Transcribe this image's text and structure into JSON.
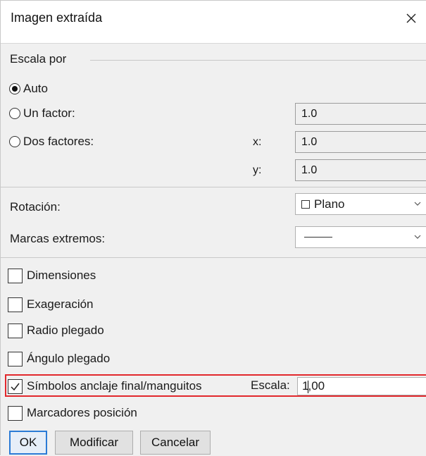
{
  "window": {
    "title": "Imagen extraída",
    "close_glyph": "×"
  },
  "scale_group": {
    "label": "Escala por",
    "options": [
      {
        "label": "Auto",
        "checked": true
      },
      {
        "label": "Un factor:",
        "checked": false
      },
      {
        "label": "Dos factores:",
        "checked": false
      }
    ],
    "un_factor_value": "1.0",
    "x_label": "x:",
    "x_value": "1.0",
    "y_label": "y:",
    "y_value": "1.0"
  },
  "rotation": {
    "label": "Rotación:",
    "value": "Plano"
  },
  "end_marks": {
    "label": "Marcas extremos:"
  },
  "checkboxes": [
    {
      "label": "Dimensiones",
      "checked": false
    },
    {
      "label": "Exageración",
      "checked": false
    },
    {
      "label": "Radio plegado",
      "checked": false
    },
    {
      "label": "Ángulo plegado",
      "checked": false
    },
    {
      "label": "Símbolos anclaje final/manguitos",
      "checked": true
    },
    {
      "label": "Marcadores posición",
      "checked": false
    }
  ],
  "symbol_scale": {
    "label": "Escala:",
    "value_before_caret": "1",
    "value_after_caret": ",00"
  },
  "buttons": {
    "ok": "OK",
    "modify": "Modificar",
    "cancel": "Cancelar"
  },
  "colors": {
    "highlight": "#e2282c",
    "default_button_border": "#2b7bd6",
    "dialog_body": "#f0f0f0"
  }
}
